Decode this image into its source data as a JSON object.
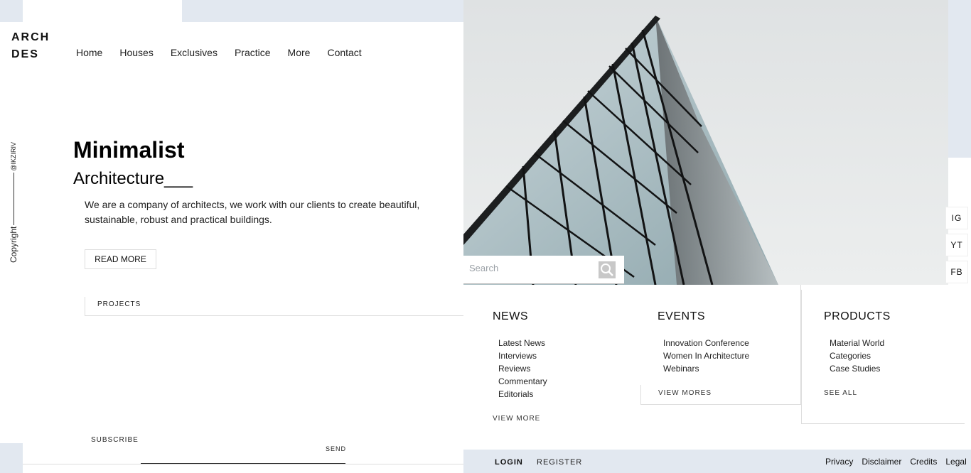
{
  "logo": {
    "line1": "ARCH",
    "line2": "DES"
  },
  "nav": {
    "items": [
      "Home",
      "Houses",
      "Exclusives",
      "Practice",
      "More",
      "Contact"
    ]
  },
  "sidebar": {
    "copyright": "Copyright",
    "handle": "@IKZIRIV"
  },
  "hero": {
    "title": "Minimalist",
    "subtitle": "Architecture___",
    "text": "We are a company of architects, we work with our clients to create beautiful, sustainable, robust and practical buildings.",
    "cta": "READ MORE",
    "tab": "PROJECTS"
  },
  "subscribe": {
    "label": "SUBSCRIBE",
    "send": "SEND",
    "placeholder": ""
  },
  "search": {
    "placeholder": "Search",
    "icon": "search-icon"
  },
  "social": [
    "IG",
    "YT",
    "FB"
  ],
  "footer": {
    "news": {
      "title": "NEWS",
      "items": [
        "Latest News",
        "Interviews",
        "Reviews",
        "Commentary",
        "Editorials"
      ],
      "more": "VIEW MORE"
    },
    "events": {
      "title": "EVENTS",
      "items": [
        "Innovation Conference",
        "Women In Architecture",
        "Webinars"
      ],
      "more": "VIEW MORES"
    },
    "products": {
      "title": "PRODUCTS",
      "items": [
        "Material World",
        "Categories",
        "Case Studies"
      ],
      "more": "SEE ALL"
    }
  },
  "bottom_bar": {
    "login": "LOGIN",
    "register": "REGISTER",
    "links": [
      "Privacy",
      "Disclaimer",
      "Credits",
      "Legal"
    ]
  },
  "colors": {
    "accent_bg": "#e2e8f0",
    "text": "#111111",
    "glass": "#b8c7cc"
  }
}
